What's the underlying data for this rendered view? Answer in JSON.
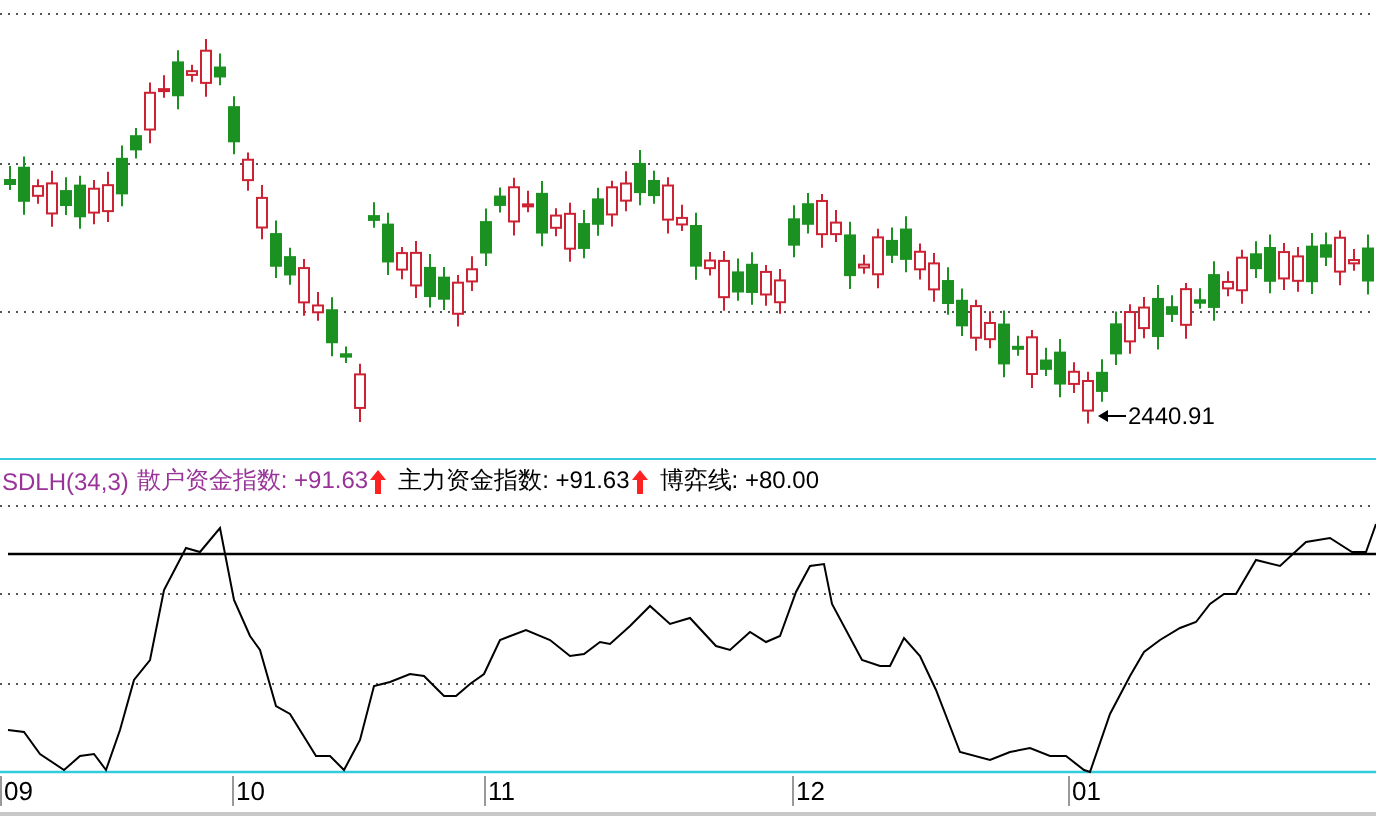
{
  "price_chart": {
    "low_marker": "2440.91"
  },
  "indicator_legend": {
    "name": "SDLH(34,3)",
    "items": [
      {
        "label": "散户资金指数: +91.63",
        "color": "#993399",
        "rising": true
      },
      {
        "label": "主力资金指数: +91.63",
        "color": "#000000",
        "rising": true
      },
      {
        "label": "博弈线: +80.00",
        "color": "#000000",
        "rising": false
      }
    ]
  },
  "time_axis": {
    "labels": [
      "09",
      "10",
      "11",
      "12",
      "01"
    ]
  }
}
